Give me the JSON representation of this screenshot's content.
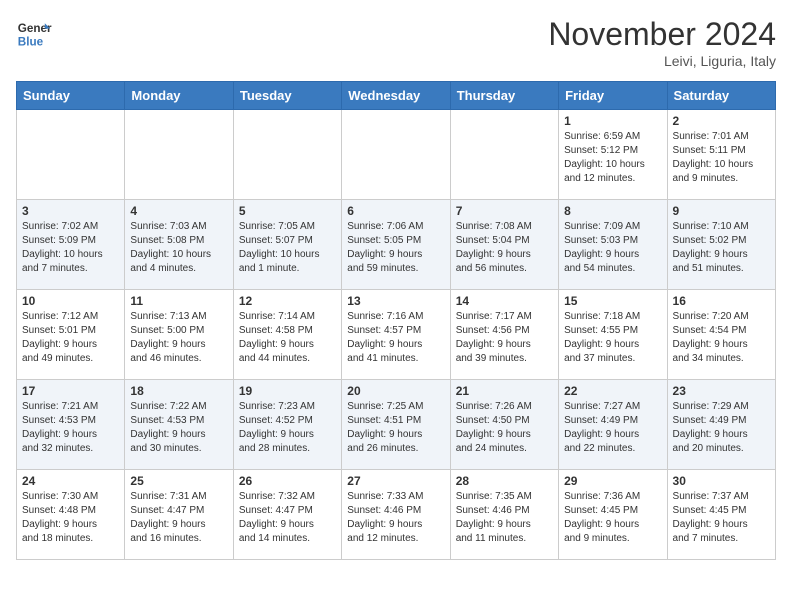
{
  "header": {
    "logo_line1": "General",
    "logo_line2": "Blue",
    "month": "November 2024",
    "location": "Leivi, Liguria, Italy"
  },
  "weekdays": [
    "Sunday",
    "Monday",
    "Tuesday",
    "Wednesday",
    "Thursday",
    "Friday",
    "Saturday"
  ],
  "weeks": [
    [
      {
        "day": "",
        "info": ""
      },
      {
        "day": "",
        "info": ""
      },
      {
        "day": "",
        "info": ""
      },
      {
        "day": "",
        "info": ""
      },
      {
        "day": "",
        "info": ""
      },
      {
        "day": "1",
        "info": "Sunrise: 6:59 AM\nSunset: 5:12 PM\nDaylight: 10 hours\nand 12 minutes."
      },
      {
        "day": "2",
        "info": "Sunrise: 7:01 AM\nSunset: 5:11 PM\nDaylight: 10 hours\nand 9 minutes."
      }
    ],
    [
      {
        "day": "3",
        "info": "Sunrise: 7:02 AM\nSunset: 5:09 PM\nDaylight: 10 hours\nand 7 minutes."
      },
      {
        "day": "4",
        "info": "Sunrise: 7:03 AM\nSunset: 5:08 PM\nDaylight: 10 hours\nand 4 minutes."
      },
      {
        "day": "5",
        "info": "Sunrise: 7:05 AM\nSunset: 5:07 PM\nDaylight: 10 hours\nand 1 minute."
      },
      {
        "day": "6",
        "info": "Sunrise: 7:06 AM\nSunset: 5:05 PM\nDaylight: 9 hours\nand 59 minutes."
      },
      {
        "day": "7",
        "info": "Sunrise: 7:08 AM\nSunset: 5:04 PM\nDaylight: 9 hours\nand 56 minutes."
      },
      {
        "day": "8",
        "info": "Sunrise: 7:09 AM\nSunset: 5:03 PM\nDaylight: 9 hours\nand 54 minutes."
      },
      {
        "day": "9",
        "info": "Sunrise: 7:10 AM\nSunset: 5:02 PM\nDaylight: 9 hours\nand 51 minutes."
      }
    ],
    [
      {
        "day": "10",
        "info": "Sunrise: 7:12 AM\nSunset: 5:01 PM\nDaylight: 9 hours\nand 49 minutes."
      },
      {
        "day": "11",
        "info": "Sunrise: 7:13 AM\nSunset: 5:00 PM\nDaylight: 9 hours\nand 46 minutes."
      },
      {
        "day": "12",
        "info": "Sunrise: 7:14 AM\nSunset: 4:58 PM\nDaylight: 9 hours\nand 44 minutes."
      },
      {
        "day": "13",
        "info": "Sunrise: 7:16 AM\nSunset: 4:57 PM\nDaylight: 9 hours\nand 41 minutes."
      },
      {
        "day": "14",
        "info": "Sunrise: 7:17 AM\nSunset: 4:56 PM\nDaylight: 9 hours\nand 39 minutes."
      },
      {
        "day": "15",
        "info": "Sunrise: 7:18 AM\nSunset: 4:55 PM\nDaylight: 9 hours\nand 37 minutes."
      },
      {
        "day": "16",
        "info": "Sunrise: 7:20 AM\nSunset: 4:54 PM\nDaylight: 9 hours\nand 34 minutes."
      }
    ],
    [
      {
        "day": "17",
        "info": "Sunrise: 7:21 AM\nSunset: 4:53 PM\nDaylight: 9 hours\nand 32 minutes."
      },
      {
        "day": "18",
        "info": "Sunrise: 7:22 AM\nSunset: 4:53 PM\nDaylight: 9 hours\nand 30 minutes."
      },
      {
        "day": "19",
        "info": "Sunrise: 7:23 AM\nSunset: 4:52 PM\nDaylight: 9 hours\nand 28 minutes."
      },
      {
        "day": "20",
        "info": "Sunrise: 7:25 AM\nSunset: 4:51 PM\nDaylight: 9 hours\nand 26 minutes."
      },
      {
        "day": "21",
        "info": "Sunrise: 7:26 AM\nSunset: 4:50 PM\nDaylight: 9 hours\nand 24 minutes."
      },
      {
        "day": "22",
        "info": "Sunrise: 7:27 AM\nSunset: 4:49 PM\nDaylight: 9 hours\nand 22 minutes."
      },
      {
        "day": "23",
        "info": "Sunrise: 7:29 AM\nSunset: 4:49 PM\nDaylight: 9 hours\nand 20 minutes."
      }
    ],
    [
      {
        "day": "24",
        "info": "Sunrise: 7:30 AM\nSunset: 4:48 PM\nDaylight: 9 hours\nand 18 minutes."
      },
      {
        "day": "25",
        "info": "Sunrise: 7:31 AM\nSunset: 4:47 PM\nDaylight: 9 hours\nand 16 minutes."
      },
      {
        "day": "26",
        "info": "Sunrise: 7:32 AM\nSunset: 4:47 PM\nDaylight: 9 hours\nand 14 minutes."
      },
      {
        "day": "27",
        "info": "Sunrise: 7:33 AM\nSunset: 4:46 PM\nDaylight: 9 hours\nand 12 minutes."
      },
      {
        "day": "28",
        "info": "Sunrise: 7:35 AM\nSunset: 4:46 PM\nDaylight: 9 hours\nand 11 minutes."
      },
      {
        "day": "29",
        "info": "Sunrise: 7:36 AM\nSunset: 4:45 PM\nDaylight: 9 hours\nand 9 minutes."
      },
      {
        "day": "30",
        "info": "Sunrise: 7:37 AM\nSunset: 4:45 PM\nDaylight: 9 hours\nand 7 minutes."
      }
    ]
  ]
}
